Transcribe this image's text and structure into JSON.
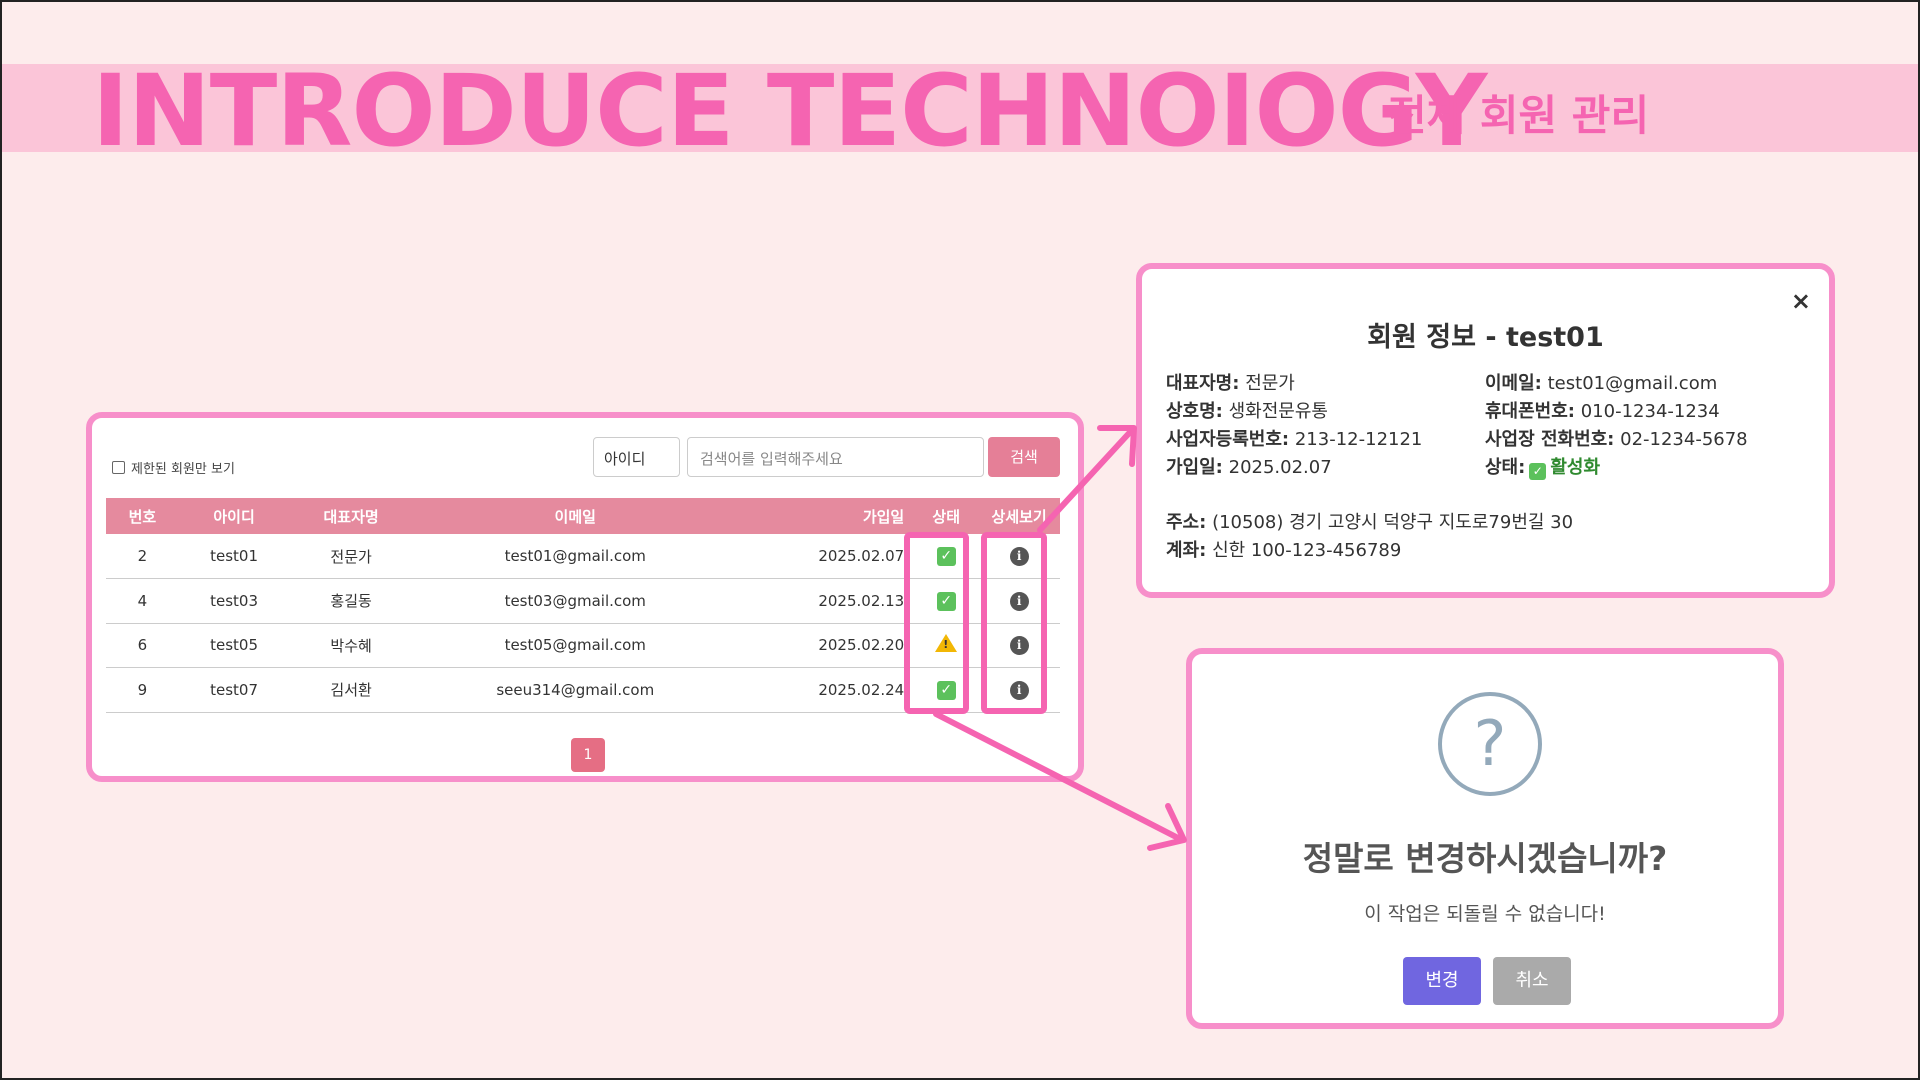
{
  "header": {
    "title": "INTRODUCE TECHNOIOGY",
    "subtitle": "전체 회원 관리"
  },
  "list": {
    "filter_label": "제한된 회원만 보기",
    "search_select": "아이디",
    "search_placeholder": "검색어를 입력해주세요",
    "search_button": "검색",
    "columns": [
      "번호",
      "아이디",
      "대표자명",
      "이메일",
      "가입일",
      "상태",
      "상세보기"
    ],
    "rows": [
      {
        "no": "2",
        "id": "test01",
        "name": "전문가",
        "email": "test01@gmail.com",
        "date": "2025.02.07",
        "status": "active"
      },
      {
        "no": "4",
        "id": "test03",
        "name": "홍길동",
        "email": "test03@gmail.com",
        "date": "2025.02.13",
        "status": "active"
      },
      {
        "no": "6",
        "id": "test05",
        "name": "박수혜",
        "email": "test05@gmail.com",
        "date": "2025.02.20",
        "status": "warning"
      },
      {
        "no": "9",
        "id": "test07",
        "name": "김서환",
        "email": "seeu314@gmail.com",
        "date": "2025.02.24",
        "status": "active"
      }
    ],
    "page": "1"
  },
  "detail": {
    "title": "회원 정보 - test01",
    "close": "×",
    "left": [
      {
        "label": "대표자명:",
        "value": "전문가"
      },
      {
        "label": "상호명:",
        "value": "생화전문유통"
      },
      {
        "label": "사업자등록번호:",
        "value": "213-12-12121"
      },
      {
        "label": "가입일:",
        "value": "2025.02.07"
      }
    ],
    "right": [
      {
        "label": "이메일:",
        "value": "test01@gmail.com"
      },
      {
        "label": "휴대폰번호:",
        "value": "010-1234-1234"
      },
      {
        "label": "사업장 전화번호:",
        "value": "02-1234-5678"
      },
      {
        "label": "상태:",
        "value": "활성화"
      }
    ],
    "address_label": "주소:",
    "address": "(10508) 경기 고양시 덕양구 지도로79번길 30",
    "account_label": "계좌:",
    "account": "신한 100-123-456789"
  },
  "confirm": {
    "icon": "?",
    "title": "정말로 변경하시겠습니까?",
    "message": "이 작업은 되돌릴 수 없습니다!",
    "confirm_button": "변경",
    "cancel_button": "취소"
  },
  "colors": {
    "accent": "#f564b1",
    "band": "#fbc5d8",
    "table_header": "#e58a9e",
    "confirm": "#7066e0"
  }
}
